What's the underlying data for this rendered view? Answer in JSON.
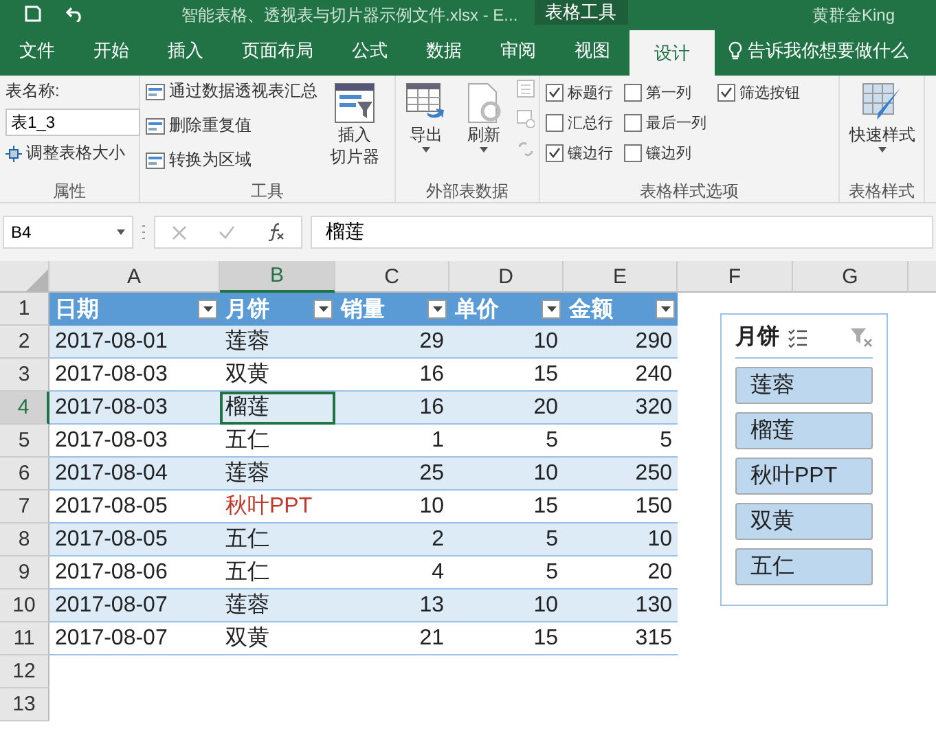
{
  "title_bar": {
    "file_title": "智能表格、透视表与切片器示例文件.xlsx  -  E...",
    "context_tab": "表格工具",
    "user": "黄群金King"
  },
  "tabs": [
    {
      "label": "文件",
      "selected": false
    },
    {
      "label": "开始",
      "selected": false
    },
    {
      "label": "插入",
      "selected": false
    },
    {
      "label": "页面布局",
      "selected": false
    },
    {
      "label": "公式",
      "selected": false
    },
    {
      "label": "数据",
      "selected": false
    },
    {
      "label": "审阅",
      "selected": false
    },
    {
      "label": "视图",
      "selected": false
    },
    {
      "label": "设计",
      "selected": true
    }
  ],
  "tell_me": "告诉我你想要做什么",
  "ribbon": {
    "properties": {
      "label": "表名称:",
      "table_name": "表1_3",
      "resize": "调整表格大小",
      "group": "属性"
    },
    "tools": {
      "buttons": [
        "通过数据透视表汇总",
        "删除重复值",
        "转换为区域"
      ],
      "slicer_line1": "插入",
      "slicer_line2": "切片器",
      "group": "工具"
    },
    "external": {
      "export": "导出",
      "refresh": "刷新",
      "group": "外部表数据"
    },
    "style_options": {
      "options": [
        {
          "label": "标题行",
          "checked": true
        },
        {
          "label": "汇总行",
          "checked": false
        },
        {
          "label": "镶边行",
          "checked": true
        },
        {
          "label": "第一列",
          "checked": false
        },
        {
          "label": "最后一列",
          "checked": false
        },
        {
          "label": "镶边列",
          "checked": false
        },
        {
          "label": "筛选按钮",
          "checked": true
        }
      ],
      "group": "表格样式选项"
    },
    "styles": {
      "quick": "快速样式",
      "group": "表格样式"
    }
  },
  "name_box": "B4",
  "formula": "榴莲",
  "columns": [
    {
      "label": "A",
      "selected": false
    },
    {
      "label": "B",
      "selected": true
    },
    {
      "label": "C",
      "selected": false
    },
    {
      "label": "D",
      "selected": false
    },
    {
      "label": "E",
      "selected": false
    },
    {
      "label": "F",
      "selected": false
    },
    {
      "label": "G",
      "selected": false
    }
  ],
  "row_numbers": [
    {
      "label": "1",
      "selected": false
    },
    {
      "label": "2",
      "selected": false
    },
    {
      "label": "3",
      "selected": false
    },
    {
      "label": "4",
      "selected": true
    },
    {
      "label": "5",
      "selected": false
    },
    {
      "label": "6",
      "selected": false
    },
    {
      "label": "7",
      "selected": false
    },
    {
      "label": "8",
      "selected": false
    },
    {
      "label": "9",
      "selected": false
    },
    {
      "label": "10",
      "selected": false
    },
    {
      "label": "11",
      "selected": false
    },
    {
      "label": "12",
      "selected": false
    },
    {
      "label": "13",
      "selected": false
    }
  ],
  "table": {
    "headers": [
      "日期",
      "月饼",
      "销量",
      "单价",
      "金额"
    ],
    "rows": [
      {
        "cells": [
          "2017-08-01",
          "莲蓉",
          "29",
          "10",
          "290"
        ],
        "selected": [
          false,
          false,
          false,
          false,
          false
        ],
        "name_highlighted": false
      },
      {
        "cells": [
          "2017-08-03",
          "双黄",
          "16",
          "15",
          "240"
        ],
        "selected": [
          false,
          false,
          false,
          false,
          false
        ],
        "name_highlighted": false
      },
      {
        "cells": [
          "2017-08-03",
          "榴莲",
          "16",
          "20",
          "320"
        ],
        "selected": [
          false,
          true,
          false,
          false,
          false
        ],
        "name_highlighted": false
      },
      {
        "cells": [
          "2017-08-03",
          "五仁",
          "1",
          "5",
          "5"
        ],
        "selected": [
          false,
          false,
          false,
          false,
          false
        ],
        "name_highlighted": false
      },
      {
        "cells": [
          "2017-08-04",
          "莲蓉",
          "25",
          "10",
          "250"
        ],
        "selected": [
          false,
          false,
          false,
          false,
          false
        ],
        "name_highlighted": false
      },
      {
        "cells": [
          "2017-08-05",
          "秋叶PPT",
          "10",
          "15",
          "150"
        ],
        "selected": [
          false,
          false,
          false,
          false,
          false
        ],
        "name_highlighted": true
      },
      {
        "cells": [
          "2017-08-05",
          "五仁",
          "2",
          "5",
          "10"
        ],
        "selected": [
          false,
          false,
          false,
          false,
          false
        ],
        "name_highlighted": false
      },
      {
        "cells": [
          "2017-08-06",
          "五仁",
          "4",
          "5",
          "20"
        ],
        "selected": [
          false,
          false,
          false,
          false,
          false
        ],
        "name_highlighted": false
      },
      {
        "cells": [
          "2017-08-07",
          "莲蓉",
          "13",
          "10",
          "130"
        ],
        "selected": [
          false,
          false,
          false,
          false,
          false
        ],
        "name_highlighted": false
      },
      {
        "cells": [
          "2017-08-07",
          "双黄",
          "21",
          "15",
          "315"
        ],
        "selected": [
          false,
          false,
          false,
          false,
          false
        ],
        "name_highlighted": false
      }
    ]
  },
  "slicer": {
    "title": "月饼",
    "items": [
      {
        "label": "莲蓉",
        "selected": true
      },
      {
        "label": "榴莲",
        "selected": true
      },
      {
        "label": "秋叶PPT",
        "selected": true
      },
      {
        "label": "双黄",
        "selected": true
      },
      {
        "label": "五仁",
        "selected": true
      }
    ]
  }
}
